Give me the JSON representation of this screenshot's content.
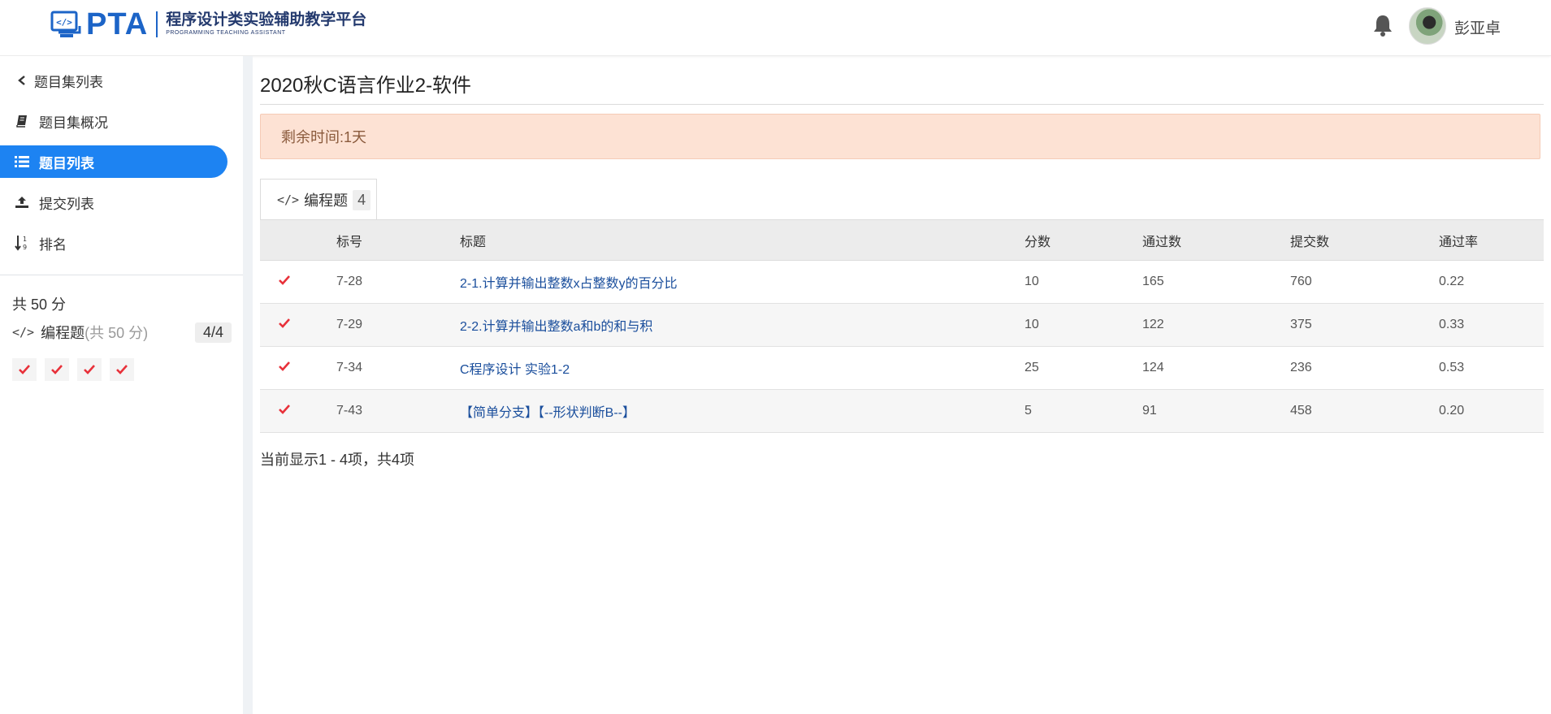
{
  "header": {
    "logo_main": "PTA",
    "logo_cn": "程序设计类实验辅助教学平台",
    "logo_en": "PROGRAMMING TEACHING ASSISTANT",
    "username": "彭亚卓",
    "brand_color": "#1c64c7"
  },
  "sidebar": {
    "items": [
      {
        "label": "题目集列表",
        "icon": "chevron-left-icon"
      },
      {
        "label": "题目集概况",
        "icon": "book-icon"
      },
      {
        "label": "题目列表",
        "icon": "list-icon",
        "active": true
      },
      {
        "label": "提交列表",
        "icon": "upload-icon"
      },
      {
        "label": "排名",
        "icon": "sort-numeric-icon"
      }
    ],
    "active_color": "#1d83f2",
    "total_score": "共 50 分",
    "category": {
      "code": "</>",
      "label": "编程题",
      "sub": "(共 50 分)",
      "count": "4/4"
    }
  },
  "main": {
    "title": "2020秋C语言作业2-软件",
    "alert": "剩余时间:1天",
    "tab": {
      "code": "</>",
      "label": "编程题",
      "count": "4"
    },
    "columns": [
      "标号",
      "标题",
      "分数",
      "通过数",
      "提交数",
      "通过率"
    ],
    "rows": [
      {
        "id": "7-28",
        "title": "2-1.计算并输出整数x占整数y的百分比",
        "score": "10",
        "passed": "165",
        "submitted": "760",
        "rate": "0.22"
      },
      {
        "id": "7-29",
        "title": "2-2.计算并输出整数a和b的和与积",
        "score": "10",
        "passed": "122",
        "submitted": "375",
        "rate": "0.33"
      },
      {
        "id": "7-34",
        "title": "C程序设计 实验1-2",
        "score": "25",
        "passed": "124",
        "submitted": "236",
        "rate": "0.53"
      },
      {
        "id": "7-43",
        "title": "【简单分支】【--形状判断B--】",
        "score": "5",
        "passed": "91",
        "submitted": "458",
        "rate": "0.20"
      }
    ],
    "summary": "当前显示1 - 4项，共4项"
  }
}
